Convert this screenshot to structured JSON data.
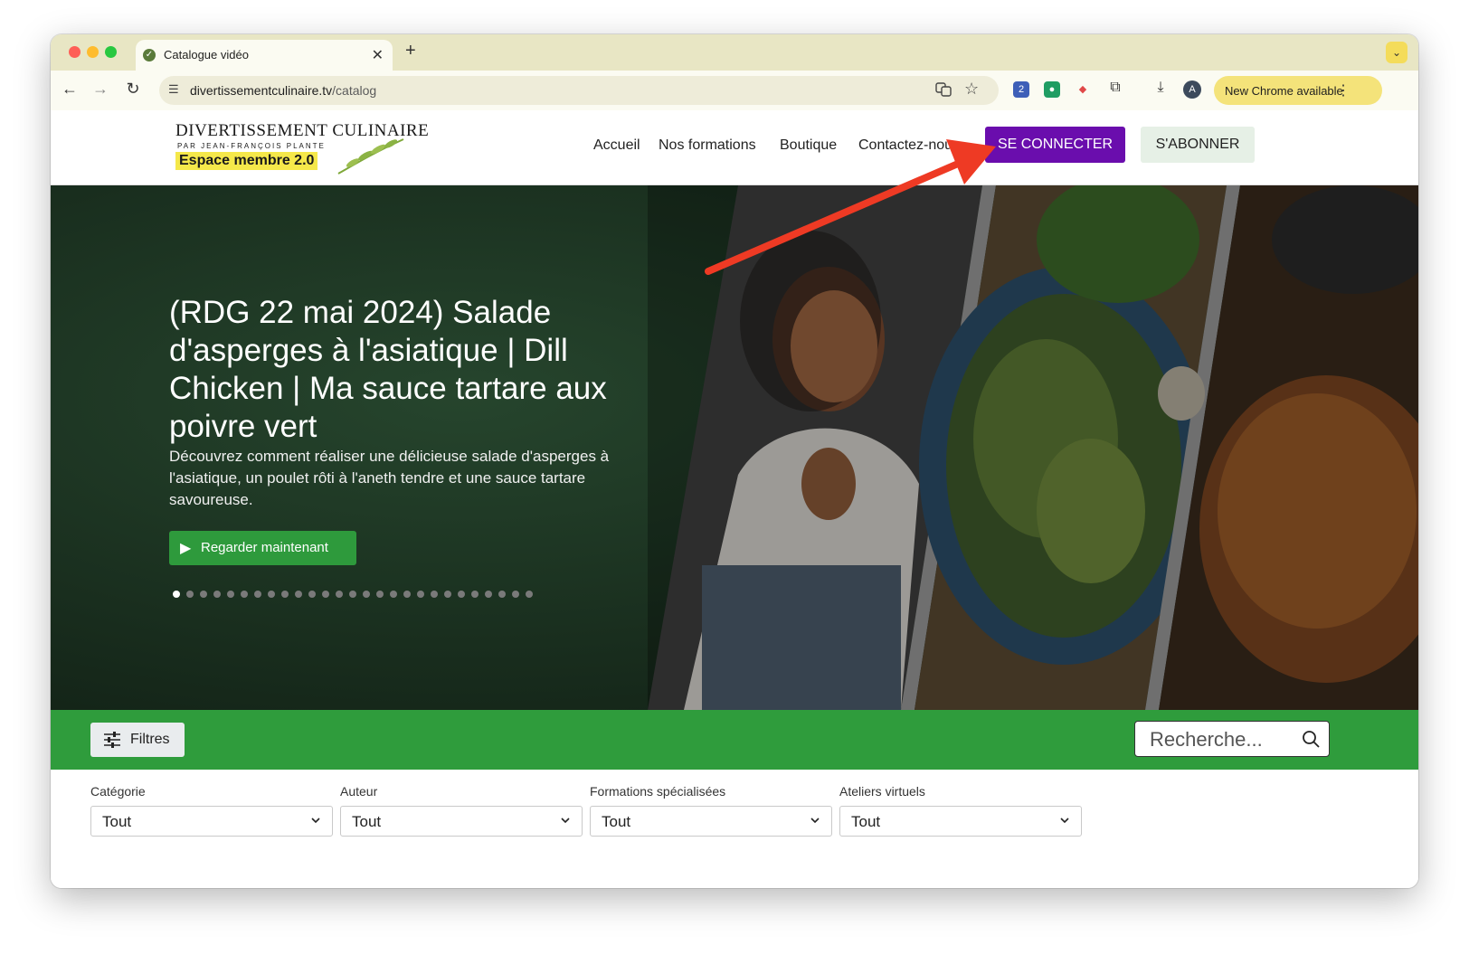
{
  "browser": {
    "tab_title": "Catalogue vidéo",
    "tab_close": "✕",
    "new_tab": "+",
    "url_domain": "divertissementculinaire.tv",
    "url_path": "/catalog",
    "update_label": "New Chrome available",
    "avatar_initial": "A",
    "ext_badge": "2"
  },
  "site": {
    "logo_line1": "DIVERTISSEMENT CULINAIRE",
    "logo_line2": "PAR JEAN-FRANÇOIS PLANTE",
    "logo_badge": "Espace membre 2.0",
    "nav": [
      "Accueil",
      "Nos formations",
      "Boutique",
      "Contactez-nous"
    ],
    "login_label": "SE CONNECTER",
    "subscribe_label": "S'ABONNER",
    "accent_purple": "#6a0dad",
    "accent_green": "#2f9c3c"
  },
  "hero": {
    "title": "(RDG 22 mai 2024) Salade d'asperges à l'asiatique | Dill Chicken | Ma sauce tartare aux poivre vert",
    "description": "Découvrez comment réaliser une délicieuse salade d'asperges à l'asiatique, un poulet rôti à l'aneth tendre et une sauce tartare savoureuse.",
    "watch_label": "Regarder maintenant",
    "slide_count": 27,
    "active_slide": 1
  },
  "filter_bar": {
    "filters_label": "Filtres",
    "search_placeholder": "Recherche..."
  },
  "filters": [
    {
      "label": "Catégorie",
      "value": "Tout"
    },
    {
      "label": "Auteur",
      "value": "Tout"
    },
    {
      "label": "Formations spécialisées",
      "value": "Tout"
    },
    {
      "label": "Ateliers virtuels",
      "value": "Tout"
    }
  ]
}
